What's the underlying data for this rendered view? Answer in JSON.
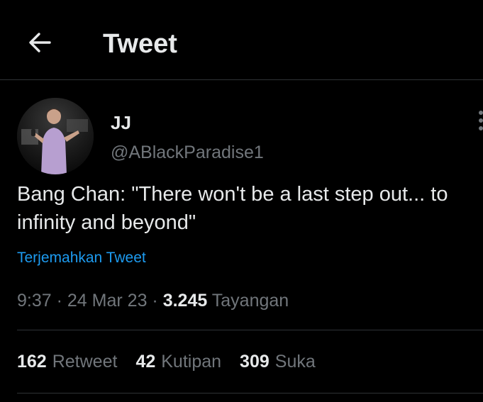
{
  "header": {
    "title": "Tweet",
    "back_icon": "arrow-left-icon"
  },
  "author": {
    "display_name": "JJ",
    "handle": "@ABlackParadise1",
    "avatar": "avatar-photo"
  },
  "tweet": {
    "text": "Bang Chan: \"There won't be a last step out... to\ninfinity and beyond\"",
    "translate_label": "Terjemahkan Tweet",
    "time": "9:37",
    "date": "24 Mar 23",
    "views_count": "3.245",
    "views_label": "Tayangan",
    "separator": "·"
  },
  "stats": {
    "retweets_count": "162",
    "retweets_label": "Retweet",
    "quotes_count": "42",
    "quotes_label": "Kutipan",
    "likes_count": "309",
    "likes_label": "Suka"
  },
  "colors": {
    "background": "#000000",
    "text_primary": "#e7e9ea",
    "text_secondary": "#71767b",
    "link": "#1d9bf0",
    "divider": "#2f3336"
  }
}
